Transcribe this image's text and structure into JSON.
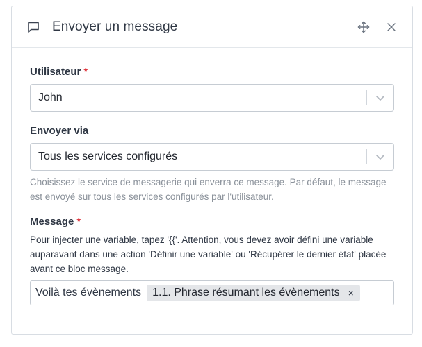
{
  "header": {
    "title": "Envoyer un message",
    "icons": {
      "message": "message-square-icon",
      "move": "move-arrows-icon",
      "close": "close-icon"
    }
  },
  "fields": {
    "user": {
      "label": "Utilisateur",
      "required_mark": "*",
      "value": "John"
    },
    "via": {
      "label": "Envoyer via",
      "value": "Tous les services configurés",
      "help": "Choisissez le service de messagerie qui enverra ce message. Par défaut, le message est envoyé sur tous les services configurés par l'utilisateur."
    },
    "message": {
      "label": "Message",
      "required_mark": "*",
      "description": "Pour injecter une variable, tapez '{{'. Attention, vous devez avoir défini une variable auparavant dans une action 'Définir une variable' ou 'Récupérer le dernier état' placée avant ce bloc message.",
      "text": "Voilà tes évènements",
      "chip": {
        "label": "1.1. Phrase résumant les évènements",
        "remove": "×"
      }
    }
  },
  "colors": {
    "required": "#e0373f",
    "help_text": "#8a919a",
    "chip_bg": "#e4e6e9"
  }
}
